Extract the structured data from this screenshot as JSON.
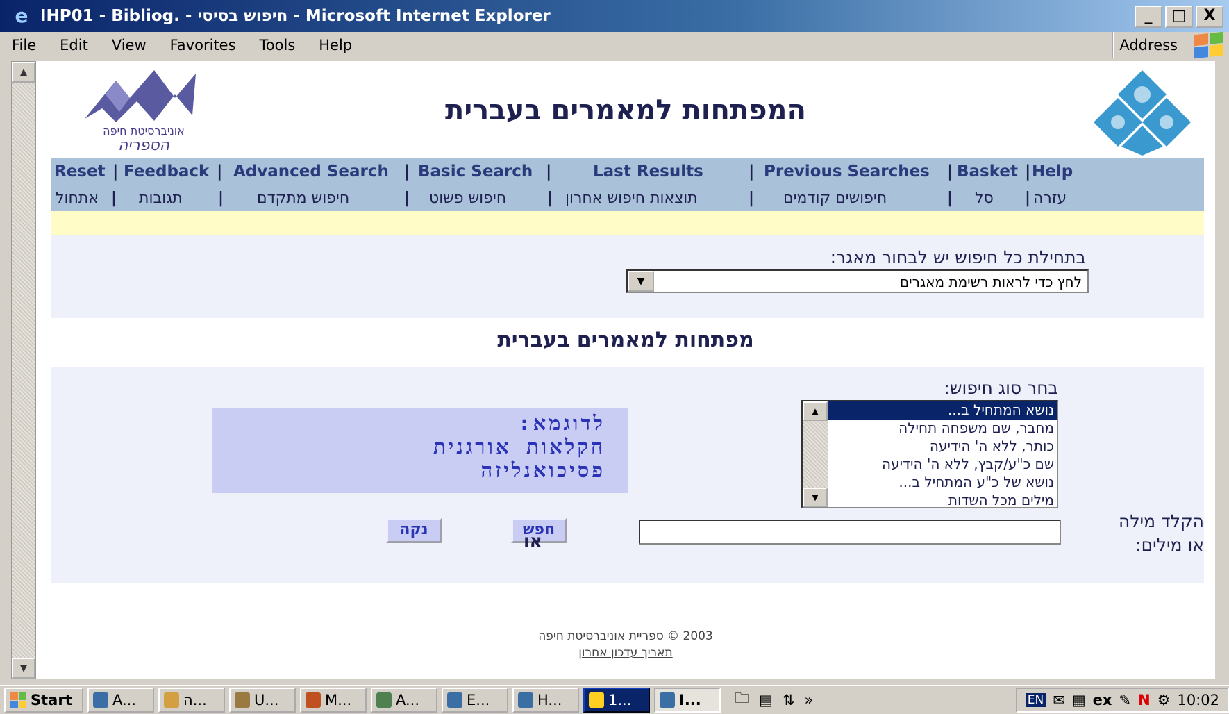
{
  "window": {
    "title": "IHP01 - Bibliog. - חיפוש בסיסי - Microsoft Internet Explorer",
    "controls": {
      "minimize": "_",
      "maximize": "□",
      "close": "X"
    }
  },
  "menu": [
    "File",
    "Edit",
    "View",
    "Favorites",
    "Tools",
    "Help"
  ],
  "address_label": "Address",
  "page": {
    "title": "המפתחות למאמרים בעברית",
    "logo_left_text": "אוניברסיטת חיפה הספריה",
    "nav_en": [
      "Reset",
      "Feedback",
      "Advanced Search",
      "Basic Search",
      "Last Results",
      "Previous Searches",
      "Basket",
      "Help"
    ],
    "nav_he": [
      "אתחול",
      "תגובות",
      "חיפוש מתקדם",
      "חיפוש פשוט",
      "תוצאות חיפוש אחרון",
      "חיפושים קודמים",
      "סל",
      "עזרה"
    ],
    "db_label": "בתחילת כל חיפוש יש לבחור מאגר:",
    "db_select_value": "לחץ כדי לראות רשימת מאגרים",
    "section_title": "מפתחות למאמרים בעברית",
    "choose_label": "בחר סוג חיפוש:",
    "search_types": [
      "נושא המתחיל ב...",
      "מחבר, שם משפחה תחילה",
      "כותר, ללא ה' הידיעה",
      "שם כ\"ע/קבץ, ללא ה' הידיעה",
      "נושא של כ\"ע המתחיל ב...",
      "מילים מכל השדות"
    ],
    "example": [
      "לדוגמא:",
      "חקלאות אורגנית",
      "פסיכואנליזה"
    ],
    "keyword_label_1": "הקלד מילה",
    "keyword_label_2": "או מילים:",
    "search_button": "חפש",
    "or_text": "או",
    "clear_button": "נקה",
    "footer_copyright": "2003 © ספריית אוניברסיטת חיפה",
    "footer_link": "תאריך עדכון אחרון"
  },
  "taskbar": {
    "start": "Start",
    "buttons": [
      "A...",
      "ה...",
      "U...",
      "M...",
      "A...",
      "E...",
      "H...",
      "1...",
      "I..."
    ],
    "overflow": "»",
    "tray_lang": "EN",
    "clock": "10:02"
  }
}
